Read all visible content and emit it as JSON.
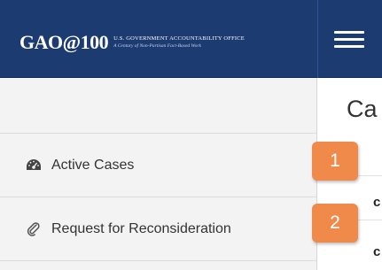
{
  "header": {
    "logo_main": "GAO@100",
    "logo_line1": "U.S. GOVERNMENT ACCOUNTABILITY OFFICE",
    "logo_line2": "A Century of Non-Partisan Fact-Based Work",
    "menu_icon": "hamburger-menu-icon",
    "background_color": "#1b3b71"
  },
  "sidebar": {
    "items": [
      {
        "label": "Active Cases",
        "icon": "tachometer-icon"
      },
      {
        "label": "Request for Reconsideration",
        "icon": "paperclip-icon"
      }
    ]
  },
  "main": {
    "title": "Ca"
  },
  "callouts": [
    {
      "label": "1",
      "color": "#f08a4b"
    },
    {
      "label": "2",
      "color": "#f08a4b"
    }
  ]
}
